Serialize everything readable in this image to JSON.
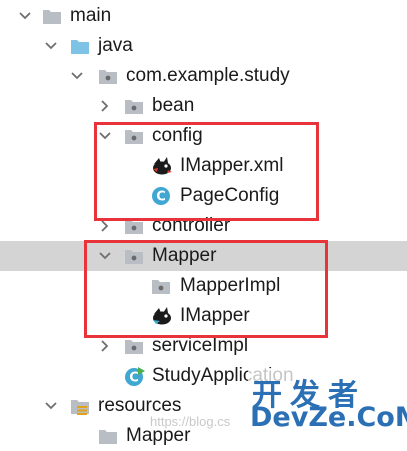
{
  "tree": {
    "main": "main",
    "java": "java",
    "package": "com.example.study",
    "bean": "bean",
    "config": "config",
    "imapper_xml": "IMapper.xml",
    "page_config": "PageConfig",
    "controller": "controller",
    "mapper": "Mapper",
    "mapper_impl": "MapperImpl",
    "imapper": "IMapper",
    "service_impl": "serviceImpl",
    "study_application": "StudyApplication",
    "resources": "resources",
    "resources_mapper": "Mapper"
  },
  "watermark": {
    "top": "开发者",
    "bottom": "DevZe.CoM",
    "url": "https://blog.cs"
  },
  "colors": {
    "folder": "#b9bec4",
    "java_folder": "#7ec3e6",
    "highlight": "#e8333a",
    "selection": "#d4d4d4",
    "class_icon": "#3fa7d1"
  }
}
